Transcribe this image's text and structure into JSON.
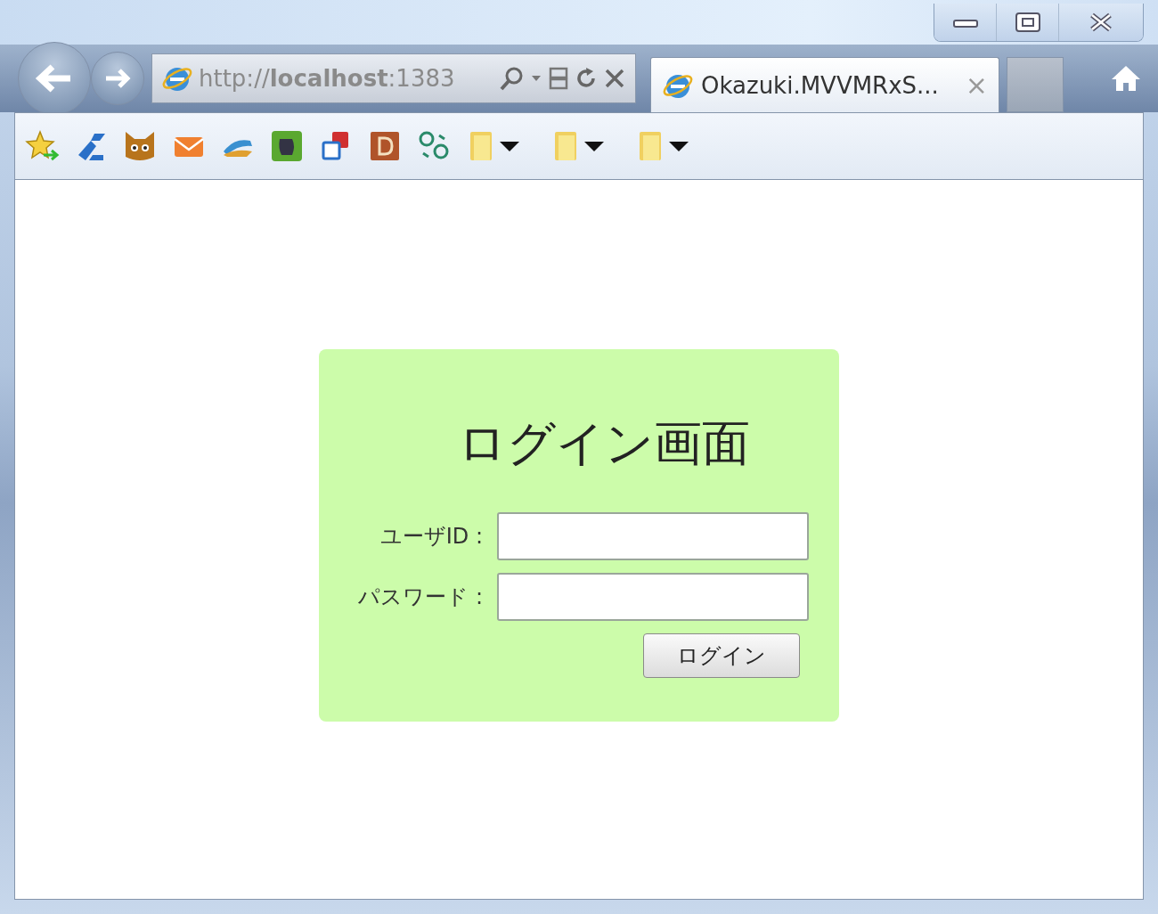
{
  "address_bar": {
    "url": "http://**localhost**:1383"
  },
  "tabs": [
    {
      "title": "Okazuki.MVVMRxS...",
      "close": "×",
      "selected": true
    }
  ],
  "login": {
    "title": "ログイン画面",
    "fields": [
      {
        "label": "ユーザID :"
      },
      {
        "label": "パスワード :"
      }
    ],
    "button": "ログイン"
  }
}
